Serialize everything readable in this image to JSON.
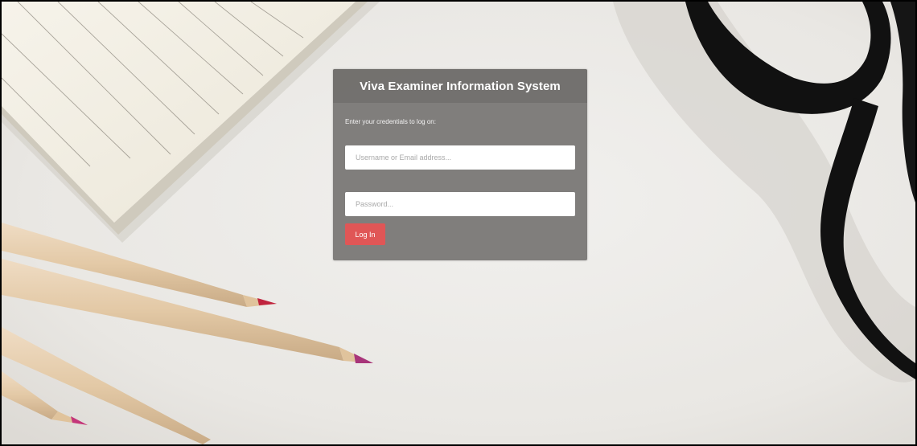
{
  "login": {
    "title": "Viva Examiner Information System",
    "instruction": "Enter your credentials to log on:",
    "username_placeholder": "Username or Email address...",
    "password_placeholder": "Password...",
    "login_button_label": "Log In",
    "button_color": "#e05656"
  },
  "background": {
    "description_items": [
      "notebook",
      "colored-pencils",
      "eyeglasses"
    ]
  }
}
